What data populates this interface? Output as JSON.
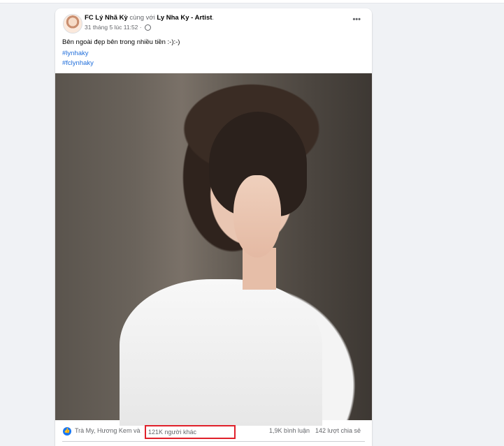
{
  "post": {
    "author": "FC Lý Nhã Kỳ",
    "with_text": "cùng với",
    "tagged": "Ly Nha Ky - Artist",
    "tagged_suffix": ".",
    "timestamp": "31 tháng 5 lúc 11:52 ·",
    "more_label": "•••",
    "caption": "Bên ngoài đẹp bên trong nhiều tiền :-):-)",
    "hashtags": [
      "#lynhaky",
      "#fclynhaky"
    ]
  },
  "reactions": {
    "reactors": "Trà My, Hương Kem và",
    "others": "121K người khác",
    "comments": "1,9K bình luận",
    "shares": "142 lượt chia sẻ",
    "like_symbol": "👍"
  },
  "colors": {
    "link": "#216fdb",
    "highlight_box": "#e0202a",
    "like_blue": "#1877f2"
  }
}
